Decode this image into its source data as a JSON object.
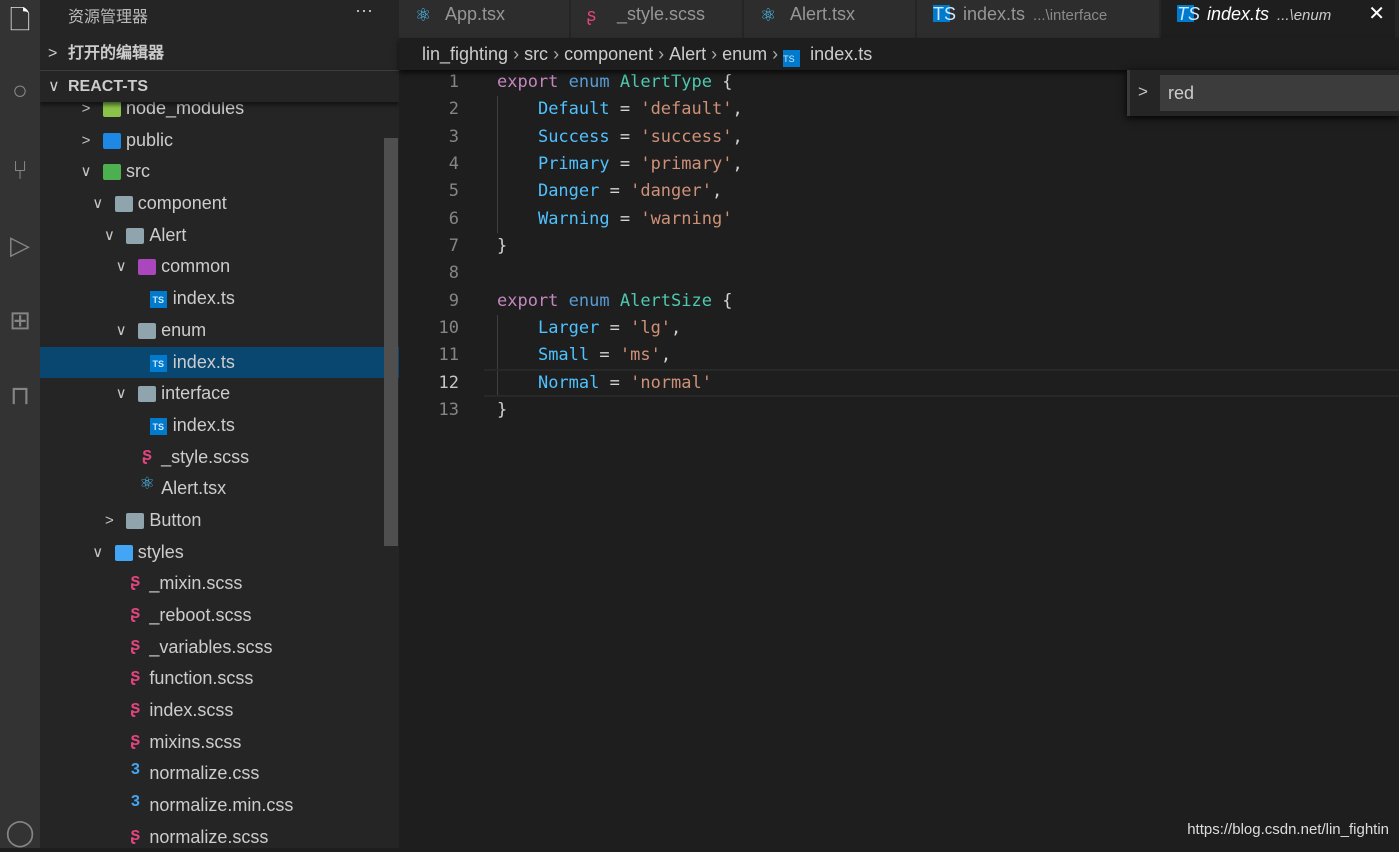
{
  "sidebar": {
    "title": "资源管理器",
    "more": "···",
    "open_editors": "打开的编辑器",
    "project": "REACT-TS",
    "tree": [
      {
        "label": "node_modules",
        "level": 1,
        "chev": ">",
        "icon": "folder-node",
        "color": "#8bc34a"
      },
      {
        "label": "public",
        "level": 1,
        "chev": ">",
        "icon": "folder-public",
        "color": "#1e88e5"
      },
      {
        "label": "src",
        "level": 1,
        "chev": "v",
        "icon": "folder-src",
        "color": "#4caf50"
      },
      {
        "label": "component",
        "level": 2,
        "chev": "v",
        "icon": "folder",
        "color": "#90a4ae"
      },
      {
        "label": "Alert",
        "level": 3,
        "chev": "v",
        "icon": "folder",
        "color": "#90a4ae"
      },
      {
        "label": "common",
        "level": 4,
        "chev": "v",
        "icon": "folder-common",
        "color": "#ab47bc"
      },
      {
        "label": "index.ts",
        "level": 5,
        "icon": "ts"
      },
      {
        "label": "enum",
        "level": 4,
        "chev": "v",
        "icon": "folder",
        "color": "#90a4ae"
      },
      {
        "label": "index.ts",
        "level": 5,
        "icon": "ts",
        "selected": true
      },
      {
        "label": "interface",
        "level": 4,
        "chev": "v",
        "icon": "folder",
        "color": "#90a4ae"
      },
      {
        "label": "index.ts",
        "level": 5,
        "icon": "ts"
      },
      {
        "label": "_style.scss",
        "level": 4,
        "icon": "sass"
      },
      {
        "label": "Alert.tsx",
        "level": 4,
        "icon": "react"
      },
      {
        "label": "Button",
        "level": 3,
        "chev": ">",
        "icon": "folder",
        "color": "#90a4ae"
      },
      {
        "label": "styles",
        "level": 2,
        "chev": "v",
        "icon": "folder-styles",
        "color": "#42a5f5"
      },
      {
        "label": "_mixin.scss",
        "level": 3,
        "icon": "sass"
      },
      {
        "label": "_reboot.scss",
        "level": 3,
        "icon": "sass"
      },
      {
        "label": "_variables.scss",
        "level": 3,
        "icon": "sass"
      },
      {
        "label": "function.scss",
        "level": 3,
        "icon": "sass"
      },
      {
        "label": "index.scss",
        "level": 3,
        "icon": "sass"
      },
      {
        "label": "mixins.scss",
        "level": 3,
        "icon": "sass"
      },
      {
        "label": "normalize.css",
        "level": 3,
        "icon": "css"
      },
      {
        "label": "normalize.min.css",
        "level": 3,
        "icon": "css"
      },
      {
        "label": "normalize.scss",
        "level": 3,
        "icon": "sass"
      }
    ]
  },
  "tabs": [
    {
      "label": "App.tsx",
      "icon": "react"
    },
    {
      "label": "_style.scss",
      "icon": "sass"
    },
    {
      "label": "Alert.tsx",
      "icon": "react"
    },
    {
      "label": "index.ts",
      "desc": "...\\interface",
      "icon": "ts"
    },
    {
      "label": "index.ts",
      "desc": "...\\enum",
      "icon": "ts",
      "active": true,
      "close": "✕"
    }
  ],
  "breadcrumb": [
    "lin_fighting",
    "src",
    "component",
    "Alert",
    "enum",
    "index.ts"
  ],
  "code": [
    [
      [
        "k",
        "export"
      ],
      [
        "",
        ""
      ],
      [
        "k2",
        " enum"
      ],
      [
        "t",
        " AlertType"
      ],
      [
        "",
        " {"
      ]
    ],
    [
      [
        "",
        "    "
      ],
      [
        "m",
        "Default"
      ],
      [
        "",
        " = "
      ],
      [
        "s",
        "'default'"
      ],
      [
        "",
        ","
      ]
    ],
    [
      [
        "",
        "    "
      ],
      [
        "m",
        "Success"
      ],
      [
        "",
        " = "
      ],
      [
        "s",
        "'success'"
      ],
      [
        "",
        ","
      ]
    ],
    [
      [
        "",
        "    "
      ],
      [
        "m",
        "Primary"
      ],
      [
        "",
        " = "
      ],
      [
        "s",
        "'primary'"
      ],
      [
        "",
        ","
      ]
    ],
    [
      [
        "",
        "    "
      ],
      [
        "m",
        "Danger"
      ],
      [
        "",
        " = "
      ],
      [
        "s",
        "'danger'"
      ],
      [
        "",
        ","
      ]
    ],
    [
      [
        "",
        "    "
      ],
      [
        "m",
        "Warning"
      ],
      [
        "",
        " = "
      ],
      [
        "s",
        "'warning'"
      ]
    ],
    [
      [
        "",
        "}"
      ]
    ],
    [],
    [
      [
        "k",
        "export"
      ],
      [
        "k2",
        " enum"
      ],
      [
        "t",
        " AlertSize"
      ],
      [
        "",
        " {"
      ]
    ],
    [
      [
        "",
        "    "
      ],
      [
        "m",
        "Larger"
      ],
      [
        "",
        " = "
      ],
      [
        "s",
        "'lg'"
      ],
      [
        "",
        ","
      ]
    ],
    [
      [
        "",
        "    "
      ],
      [
        "m",
        "Small"
      ],
      [
        "",
        " = "
      ],
      [
        "s",
        "'ms'"
      ],
      [
        "",
        ","
      ]
    ],
    [
      [
        "",
        "    "
      ],
      [
        "m",
        "Normal"
      ],
      [
        "",
        " = "
      ],
      [
        "s",
        "'normal'"
      ]
    ],
    [
      [
        "",
        "}"
      ]
    ]
  ],
  "current_line": 12,
  "find": {
    "value": "red"
  },
  "watermark": "https://blog.csdn.net/lin_fightin"
}
